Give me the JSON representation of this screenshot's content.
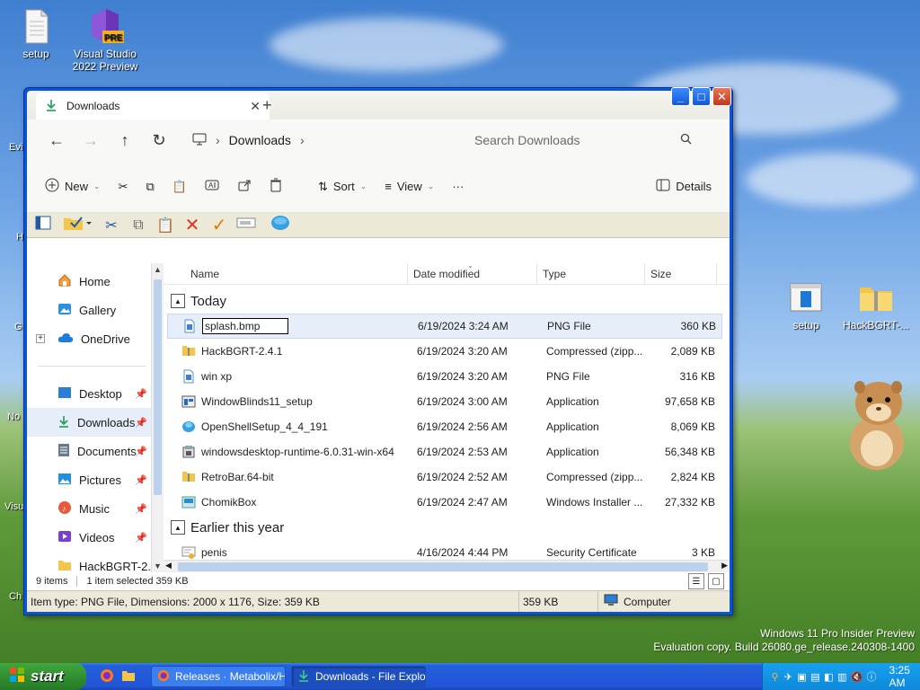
{
  "desktop": {
    "icons": [
      {
        "label": "setup"
      },
      {
        "label": "Visual Studio 2022 Preview",
        "badge": "PRE"
      },
      {
        "label": "setup"
      },
      {
        "label": "HackBGRT-..."
      }
    ],
    "partial_labels": [
      "Evi",
      "H",
      "G",
      "No",
      "Visu",
      "Ch"
    ]
  },
  "window": {
    "tab_title": "Downloads",
    "new_tab": "+",
    "controls": {
      "minimize": "_",
      "maximize": "□",
      "close": "✕"
    }
  },
  "addressbar": {
    "breadcrumb": "Downloads",
    "search_placeholder": "Search Downloads"
  },
  "commandbar": {
    "new_label": "New",
    "sort_label": "Sort",
    "view_label": "View",
    "more_label": "···",
    "details_label": "Details"
  },
  "nav": {
    "items": [
      {
        "label": "Home",
        "icon": "home-icon"
      },
      {
        "label": "Gallery",
        "icon": "gallery-icon"
      },
      {
        "label": "OneDrive",
        "icon": "cloud-icon"
      },
      {
        "label": "Desktop",
        "icon": "desktop-icon"
      },
      {
        "label": "Downloads",
        "icon": "download-icon"
      },
      {
        "label": "Documents",
        "icon": "documents-icon"
      },
      {
        "label": "Pictures",
        "icon": "pictures-icon"
      },
      {
        "label": "Music",
        "icon": "music-icon"
      },
      {
        "label": "Videos",
        "icon": "videos-icon"
      },
      {
        "label": "HackBGRT-2.",
        "icon": "folder-icon"
      }
    ]
  },
  "columns": {
    "name": "Name",
    "date": "Date modified",
    "type": "Type",
    "size": "Size"
  },
  "groups": [
    {
      "title": "Today",
      "files": [
        {
          "name": "splash.bmp",
          "date": "6/19/2024 3:24 AM",
          "type": "PNG File",
          "size": "360 KB",
          "icon": "image-file-icon"
        },
        {
          "name": "HackBGRT-2.4.1",
          "date": "6/19/2024 3:20 AM",
          "type": "Compressed (zipp...",
          "size": "2,089 KB",
          "icon": "zip-folder-icon"
        },
        {
          "name": "win xp",
          "date": "6/19/2024 3:20 AM",
          "type": "PNG File",
          "size": "316 KB",
          "icon": "image-file-icon"
        },
        {
          "name": "WindowBlinds11_setup",
          "date": "6/19/2024 3:00 AM",
          "type": "Application",
          "size": "97,658 KB",
          "icon": "app-icon"
        },
        {
          "name": "OpenShellSetup_4_4_191",
          "date": "6/19/2024 2:56 AM",
          "type": "Application",
          "size": "8,069 KB",
          "icon": "shell-icon"
        },
        {
          "name": "windowsdesktop-runtime-6.0.31-win-x64",
          "date": "6/19/2024 2:53 AM",
          "type": "Application",
          "size": "56,348 KB",
          "icon": "installer-icon"
        },
        {
          "name": "RetroBar.64-bit",
          "date": "6/19/2024 2:52 AM",
          "type": "Compressed (zipp...",
          "size": "2,824 KB",
          "icon": "zip-folder-icon"
        },
        {
          "name": "ChomikBox",
          "date": "6/19/2024 2:47 AM",
          "type": "Windows Installer ...",
          "size": "27,332 KB",
          "icon": "msi-icon"
        }
      ]
    },
    {
      "title": "Earlier this year",
      "files": [
        {
          "name": "penis",
          "date": "4/16/2024 4:44 PM",
          "type": "Security Certificate",
          "size": "3 KB",
          "icon": "certificate-icon"
        }
      ]
    }
  ],
  "status": {
    "items": "9 items",
    "selected": "1 item selected  359 KB",
    "item_info": "Item type: PNG File, Dimensions: 2000 x 1176, Size: 359 KB",
    "size": "359 KB",
    "location": "Computer"
  },
  "watermark": {
    "line1": "Windows 11 Pro Insider Preview",
    "line2": "Evaluation copy. Build 26080.ge_release.240308-1400"
  },
  "taskbar": {
    "start_label": "start",
    "tasks": [
      {
        "label": "Releases · Metabolix/H..."
      },
      {
        "label": "Downloads - File Explo..."
      }
    ],
    "clock": "3:25 AM"
  },
  "colors": {
    "xp_blue": "#0a54d6",
    "selection": "#e5eef9",
    "start_green": "#2e8b2e"
  }
}
